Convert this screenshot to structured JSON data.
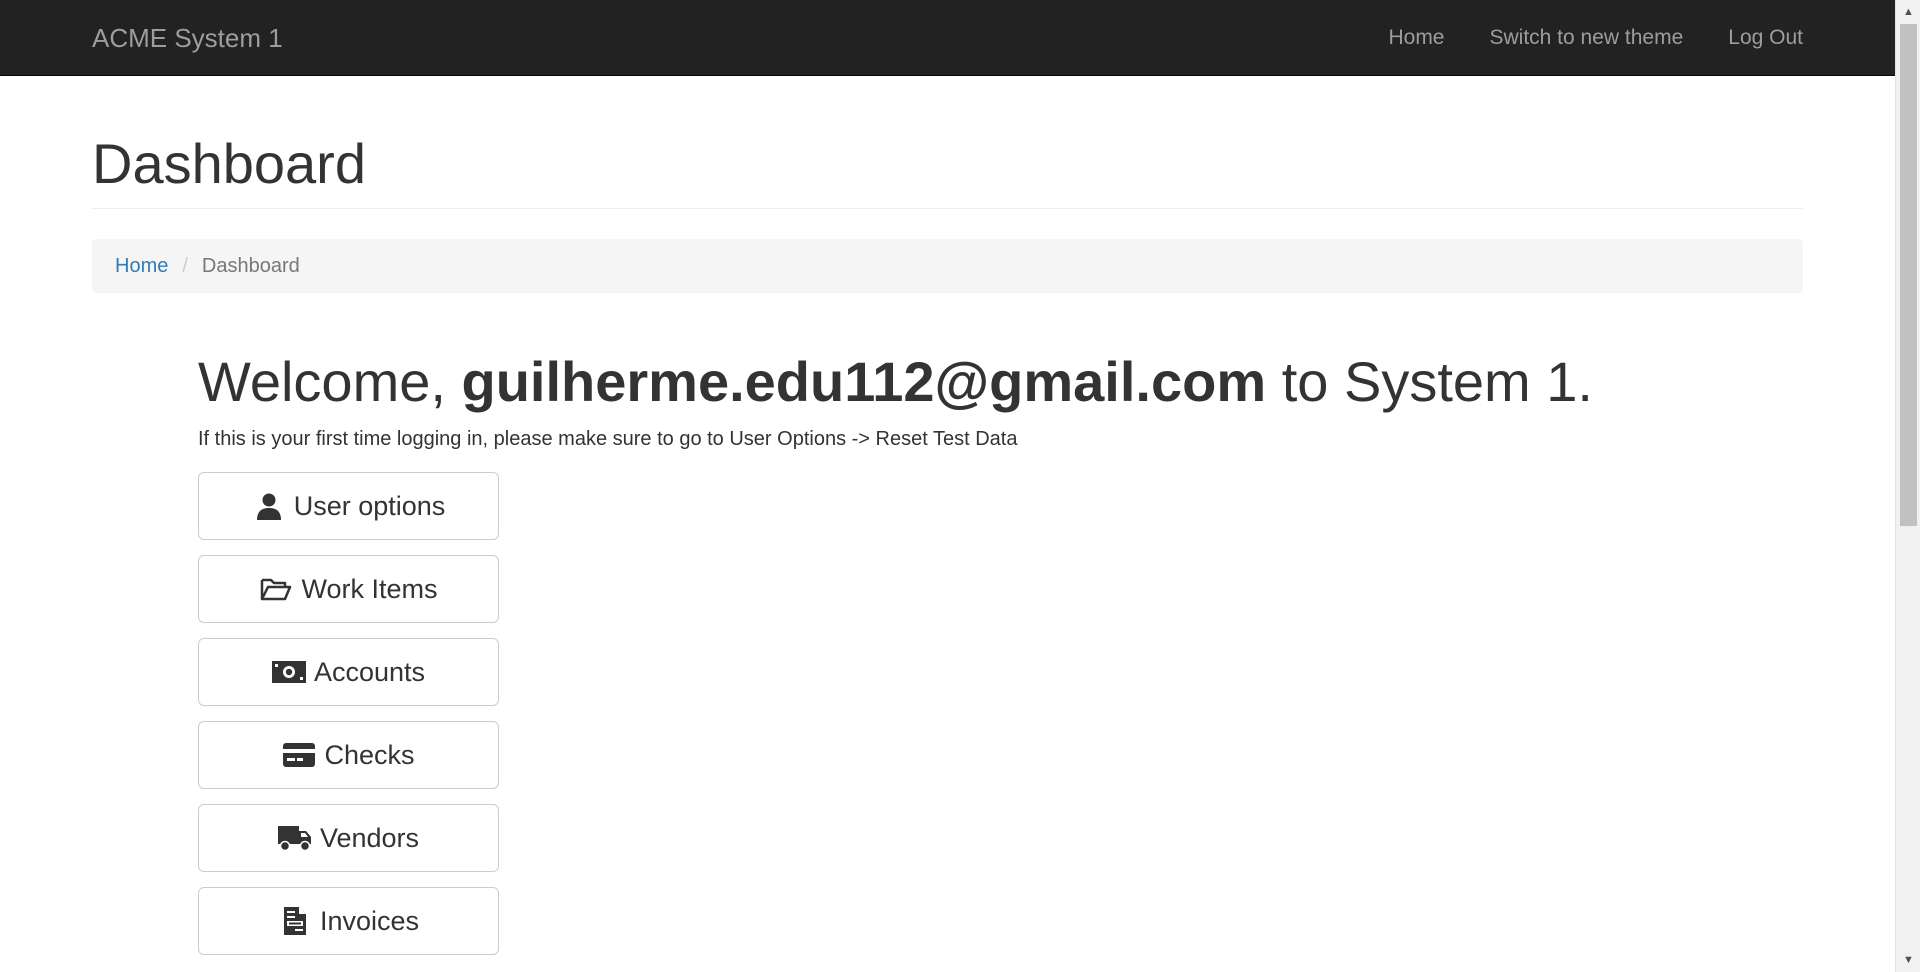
{
  "navbar": {
    "brand": "ACME System 1",
    "links": [
      "Home",
      "Switch to new theme",
      "Log Out"
    ]
  },
  "page": {
    "title": "Dashboard"
  },
  "breadcrumb": {
    "home": "Home",
    "separator": "/",
    "current": "Dashboard"
  },
  "welcome": {
    "prefix": "Welcome, ",
    "user": "guilherme.edu112@gmail.com",
    "suffix": " to System 1.",
    "hint": "If this is your first time logging in, please make sure to go to User Options -> Reset Test Data"
  },
  "menu": [
    {
      "label": "User options",
      "icon": "user-icon"
    },
    {
      "label": "Work Items",
      "icon": "folder-open-icon"
    },
    {
      "label": "Accounts",
      "icon": "money-bill-icon"
    },
    {
      "label": "Checks",
      "icon": "credit-card-icon"
    },
    {
      "label": "Vendors",
      "icon": "truck-icon"
    },
    {
      "label": "Invoices",
      "icon": "file-invoice-icon"
    }
  ],
  "colors": {
    "navbar_bg": "#222222",
    "navbar_text": "#9d9d9d",
    "link": "#337ab7",
    "breadcrumb_bg": "#f5f5f5"
  }
}
